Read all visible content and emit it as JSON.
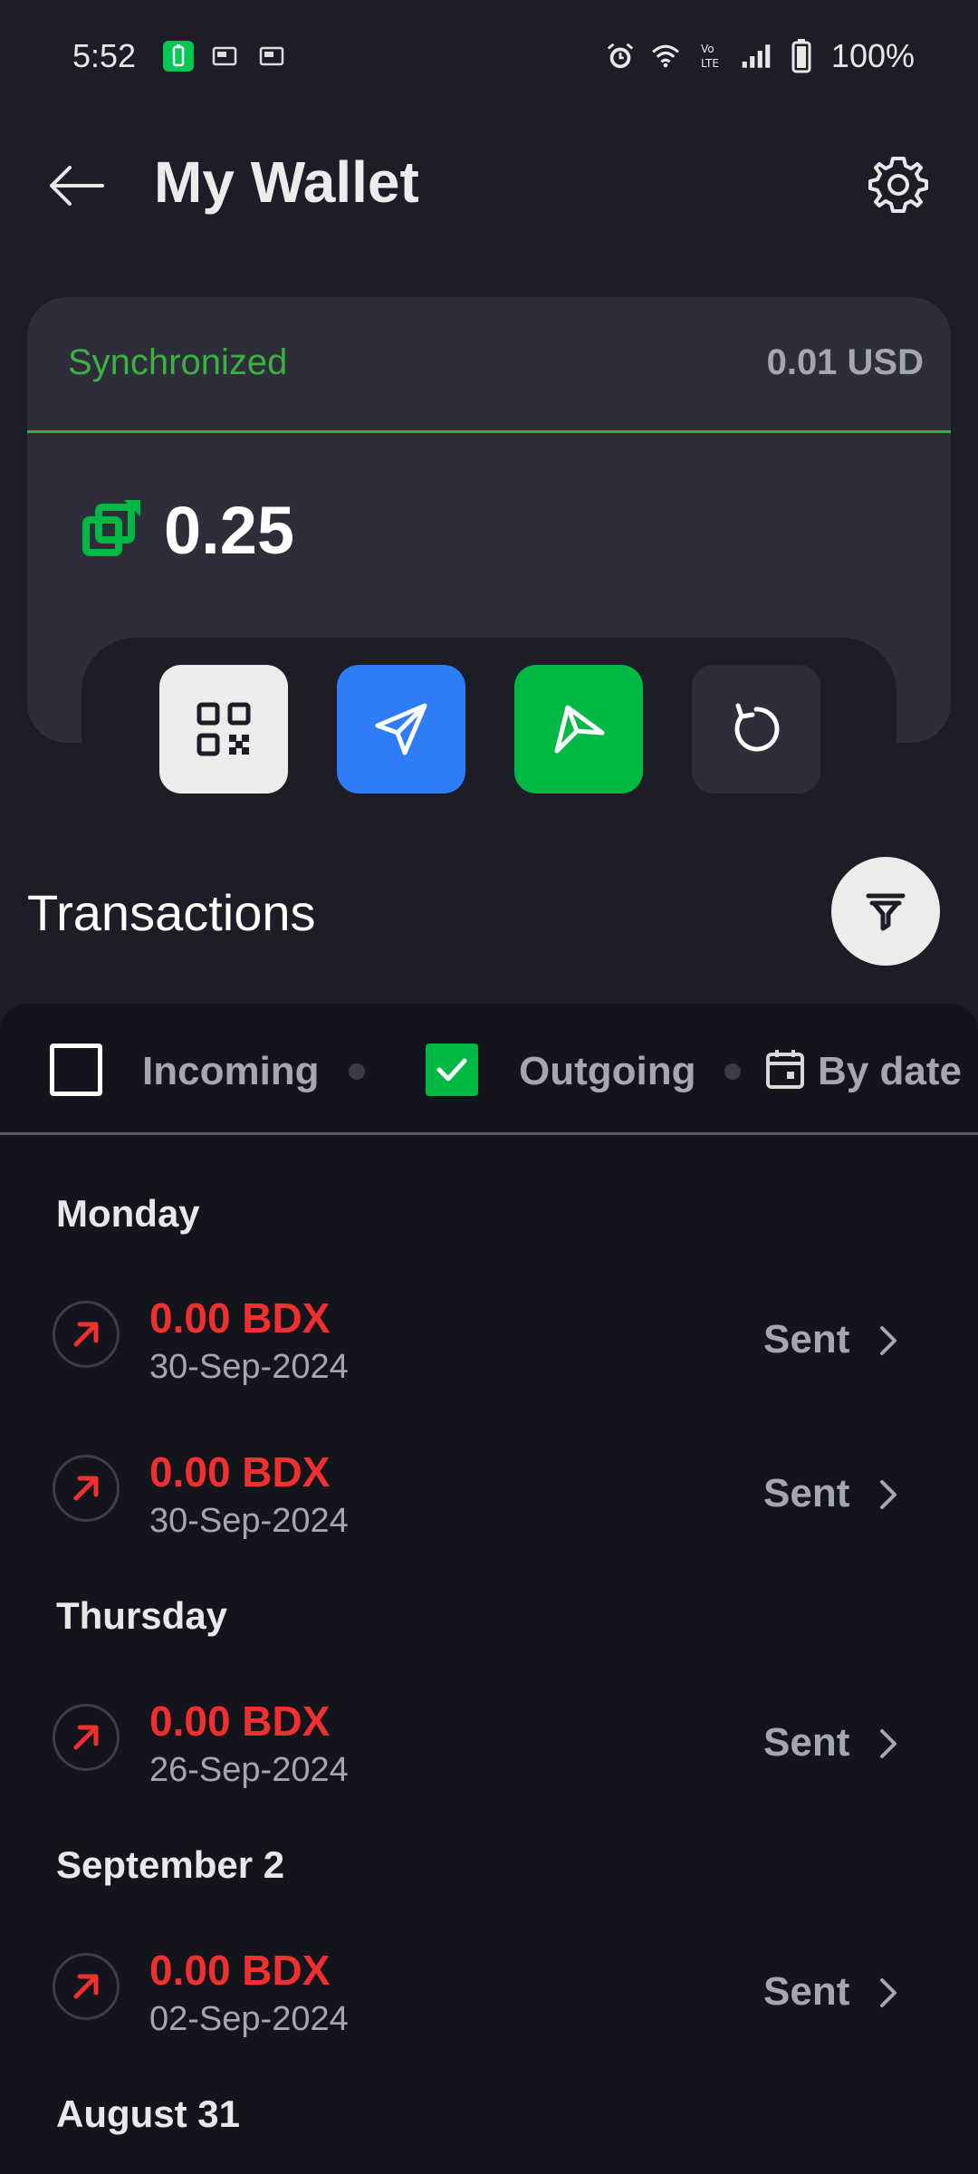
{
  "status_bar": {
    "time": "5:52",
    "battery": "100%"
  },
  "header": {
    "title": "My Wallet"
  },
  "wallet": {
    "sync_status": "Synchronized",
    "usd_value": "0.01 USD",
    "balance": "0.25"
  },
  "transactions": {
    "title": "Transactions",
    "filters": {
      "incoming_label": "Incoming",
      "incoming_checked": false,
      "outgoing_label": "Outgoing",
      "outgoing_checked": true,
      "by_date_label": "By date"
    },
    "groups": [
      {
        "day": "Monday",
        "items": [
          {
            "amount": "0.00 BDX",
            "date": "30-Sep-2024",
            "status": "Sent"
          },
          {
            "amount": "0.00 BDX",
            "date": "30-Sep-2024",
            "status": "Sent"
          }
        ]
      },
      {
        "day": "Thursday",
        "items": [
          {
            "amount": "0.00 BDX",
            "date": "26-Sep-2024",
            "status": "Sent"
          }
        ]
      },
      {
        "day": "September 2",
        "items": [
          {
            "amount": "0.00 BDX",
            "date": "02-Sep-2024",
            "status": "Sent"
          }
        ]
      },
      {
        "day": "August 31",
        "items": []
      }
    ]
  },
  "colors": {
    "background": "#1c1d26",
    "card": "#2d2e3a",
    "accent_green": "#00b944",
    "accent_blue": "#2e7cf6",
    "sent_red": "#f0302e"
  }
}
